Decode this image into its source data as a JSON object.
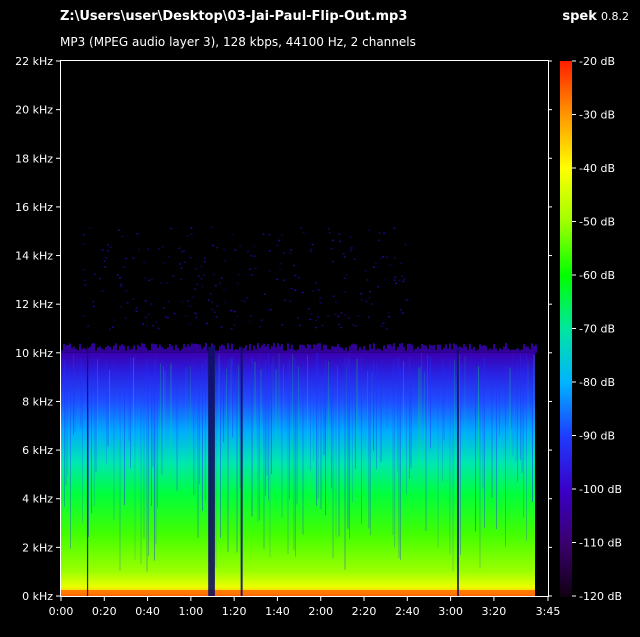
{
  "file_path": "Z:\\Users\\user\\Desktop\\03-Jai-Paul-Flip-Out.mp3",
  "file_info": "MP3 (MPEG audio layer 3), 128 kbps, 44100 Hz, 2 channels",
  "app": {
    "name": "spek",
    "version": "0.8.2"
  },
  "chart_data": {
    "type": "heatmap",
    "title": "Z:\\Users\\user\\Desktop\\03-Jai-Paul-Flip-Out.mp3",
    "subtitle": "MP3 (MPEG audio layer 3), 128 kbps, 44100 Hz, 2 channels",
    "x_ticks": [
      "0:00",
      "0:20",
      "0:40",
      "1:00",
      "1:20",
      "1:40",
      "2:00",
      "2:20",
      "2:40",
      "3:00",
      "3:20",
      "3:45"
    ],
    "y_ticks": [
      "0 kHz",
      "2 kHz",
      "4 kHz",
      "6 kHz",
      "8 kHz",
      "10 kHz",
      "12 kHz",
      "14 kHz",
      "16 kHz",
      "18 kHz",
      "20 kHz",
      "22 kHz"
    ],
    "y_range_khz": [
      0,
      22
    ],
    "x_range_seconds": [
      0,
      225
    ],
    "colorbar_ticks": [
      "-20 dB",
      "-30 dB",
      "-40 dB",
      "-50 dB",
      "-60 dB",
      "-70 dB",
      "-80 dB",
      "-90 dB",
      "-100 dB",
      "-110 dB",
      "-120 dB"
    ],
    "colorbar_range_db": [
      -120,
      -20
    ],
    "colorscale": [
      "#100010",
      "#3a006e",
      "#3a00c8",
      "#1e3cff",
      "#00b4ff",
      "#00e6a0",
      "#00ff00",
      "#a0ff00",
      "#ffff00",
      "#ff9600",
      "#ff1e00"
    ],
    "content_cutoff_khz": 10,
    "audio_end_seconds": 219
  }
}
